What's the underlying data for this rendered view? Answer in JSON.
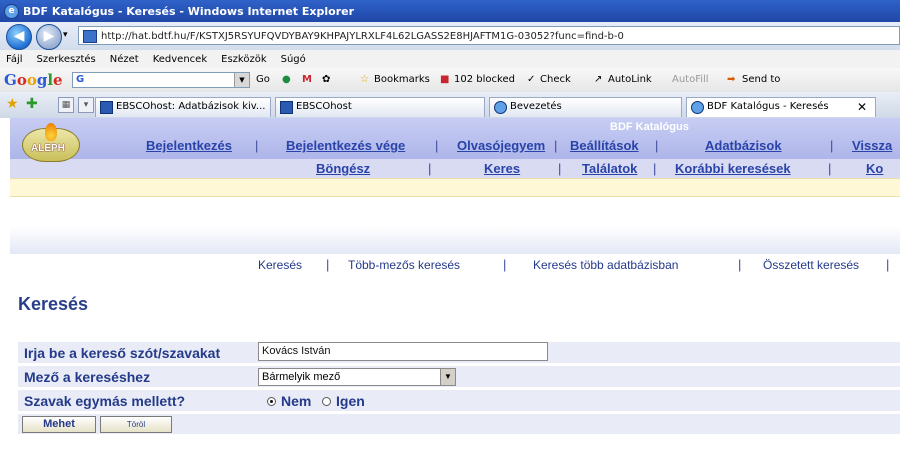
{
  "window": {
    "title": "BDF Katalógus - Keresés - Windows Internet Explorer"
  },
  "address": {
    "url": "http://hat.bdtf.hu/F/KSTXJ5RSYUFQVDYBAY9KHPAJYLRXLF4L62LGASS2E8HJAFTM1G-03052?func=find-b-0"
  },
  "menu": [
    "Fájl",
    "Szerkesztés",
    "Nézet",
    "Kedvencek",
    "Eszközök",
    "Súgó"
  ],
  "google_toolbar": {
    "logo": "Google",
    "search_value": "G",
    "go": "Go",
    "bookmarks": "Bookmarks",
    "blocked": "102 blocked",
    "check": "Check",
    "autolink": "AutoLink",
    "autofill": "AutoFill",
    "sendto": "Send to"
  },
  "tabs": [
    {
      "label": "EBSCOhost: Adatbázisok kiv..."
    },
    {
      "label": "EBSCOhost"
    },
    {
      "label": "Bevezetés"
    },
    {
      "label": "BDF Katalógus - Keresés",
      "active": true
    }
  ],
  "catalog": {
    "title": "BDF Katalógus",
    "logo_text": "ALEPH",
    "top_links": [
      "Bejelentkezés",
      "Bejelentkezés vége",
      "Olvasójegyem",
      "Beállítások",
      "Adatbázisok",
      "Vissza"
    ],
    "second_links": [
      "Böngész",
      "Keres",
      "Találatok",
      "Korábbi keresések",
      "Ko"
    ],
    "subnav": [
      "Keresés",
      "Több-mezős keresés",
      "Keresés több adatbázisban",
      "Összetett keresés"
    ]
  },
  "form": {
    "page_title": "Keresés",
    "term_label": "Irja be a kereső szót/szavakat",
    "term_value": "Kovács István",
    "field_label": "Mező a kereséshez",
    "field_value": "Bármelyik mező",
    "adjacent_label": "Szavak egymás mellett?",
    "adjacent_no": "Nem",
    "adjacent_yes": "Igen",
    "adjacent_selected": "Nem",
    "submit": "Mehet",
    "clear": "Töröl"
  }
}
